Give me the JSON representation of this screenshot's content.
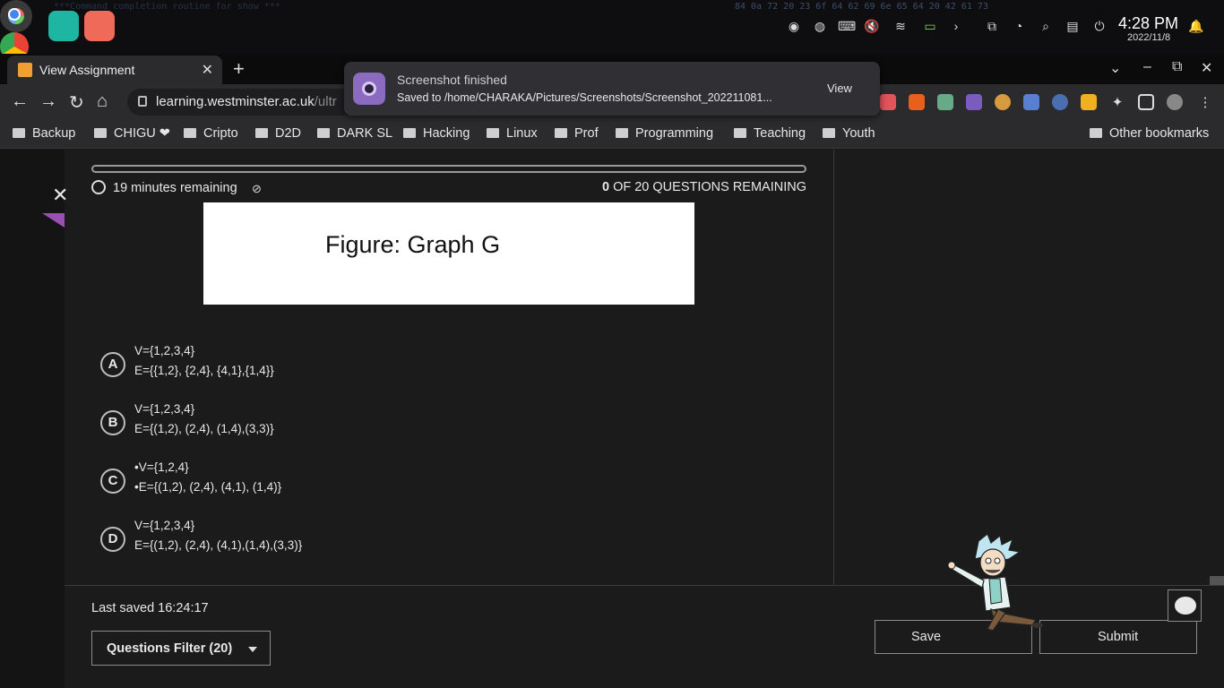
{
  "os_bar": {
    "clock": "4:28 PM",
    "date": "2022/11/8",
    "hex_noise_right": "84 0a 72 20 23 6f 64 62 69 6e 65 64 20 42 61 73",
    "hex_noise_left": "***Command completion routine for show ***"
  },
  "browser": {
    "tab_title": "View Assignment",
    "url_host": "learning.westminster.ac.uk",
    "url_rest": "/ultr",
    "bookmarks": [
      "Backup",
      "CHIGU ❤",
      "Cripto",
      "D2D",
      "DARK SL",
      "Hacking",
      "Linux",
      "Prof",
      "Programming",
      "Teaching",
      "Youth"
    ],
    "other_bookmarks": "Other bookmarks"
  },
  "notification": {
    "title": "Screenshot finished",
    "body": "Saved to /home/CHARAKA/Pictures/Screenshots/Screenshot_202211081...",
    "action": "View"
  },
  "assignment": {
    "time_remaining": "19 minutes remaining",
    "questions_remaining_count": "0",
    "questions_remaining_label": "OF 20 QUESTIONS REMAINING",
    "figure_caption": "Figure: Graph G",
    "options": [
      {
        "letter": "A",
        "line1": "V={1,2,3,4}",
        "line2": "E={{1,2}, {2,4}, {4,1},{1,4}}"
      },
      {
        "letter": "B",
        "line1": "V={1,2,3,4}",
        "line2": "E={(1,2), (2,4), (1,4),(3,3)}"
      },
      {
        "letter": "C",
        "line1": "•V={1,2,4}",
        "line2": "•E={(1,2), (2,4), (4,1), (1,4)}"
      },
      {
        "letter": "D",
        "line1": "V={1,2,3,4}",
        "line2": "E={(1,2), (2,4), (4,1),(1,4),(3,3)}"
      }
    ],
    "last_saved": "Last saved 16:24:17",
    "filter_label": "Questions Filter (20)",
    "save_label": "Save",
    "submit_label": "Submit"
  },
  "colors": {
    "accent_purple": "#9a4fb5",
    "background": "#1b1b1b"
  }
}
